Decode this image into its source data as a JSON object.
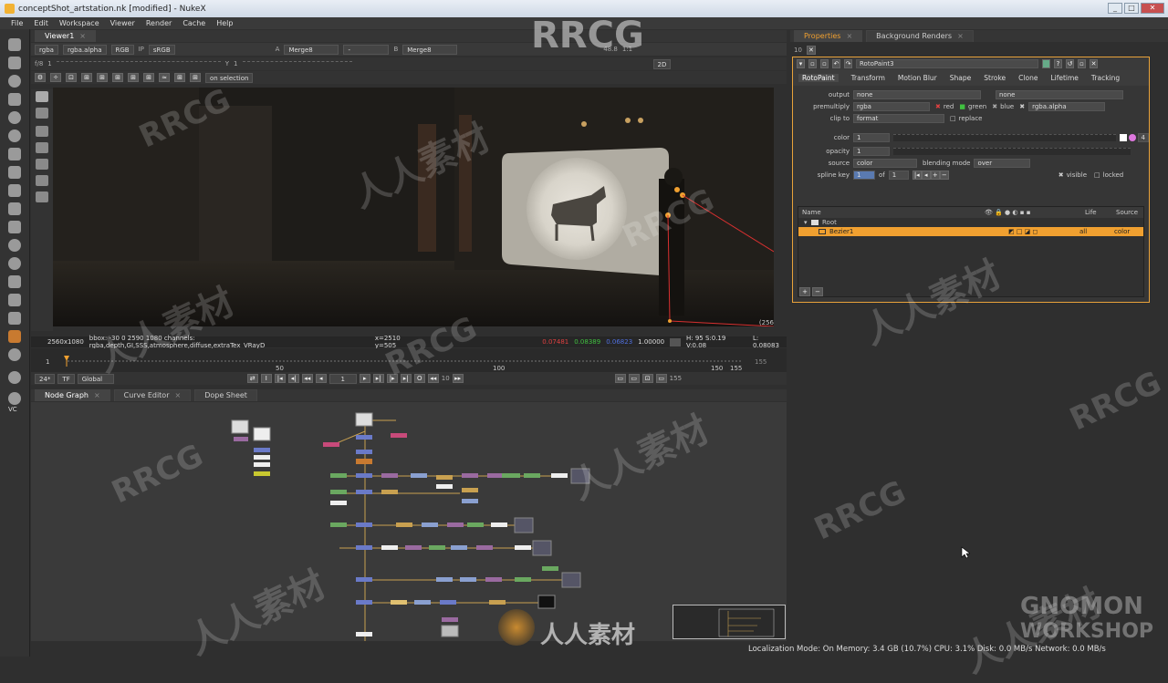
{
  "window": {
    "title": "conceptShot_artstation.nk [modified] - NukeX"
  },
  "menu": [
    "File",
    "Edit",
    "Workspace",
    "Viewer",
    "Render",
    "Cache",
    "Help"
  ],
  "viewer_tab": {
    "label": "Viewer1"
  },
  "viewer_controls": {
    "channels": "rgba",
    "alpha": "rgba.alpha",
    "colorspace": "RGB",
    "ip": "IP",
    "lut": "sRGB",
    "input_a_label": "A",
    "input_a": "Merge8",
    "dash": "-",
    "input_b_label": "B",
    "input_b": "Merge8",
    "gain": "48.8",
    "zoom": "1:1",
    "mode": "2D",
    "fstop": "f/8",
    "frame": "1",
    "gamma_label": "Y",
    "gamma": "1",
    "on_selection": "on selection"
  },
  "info": {
    "resolution": "2560x1080",
    "bbox": "bbox: -30 0 2590 1080 channels: rgba,depth,GI,SSS,atmosphere,diffuse,extraTex_VRayD",
    "coords": "x=2510 y=505",
    "r": "0.07481",
    "g": "0.08389",
    "b": "0.06823",
    "a": "1.00000",
    "hsv": "H: 95 S:0.19 V:0.08",
    "lum": "L: 0.08083",
    "overflow": "(256"
  },
  "timeline": {
    "start": "1",
    "mid1": "50",
    "mid2": "100",
    "mark150": "150",
    "end": "155",
    "end_frame": "155",
    "fps": "24*",
    "tf": "TF",
    "scope": "Global",
    "current": "1",
    "step": "10"
  },
  "graph_tabs": [
    "Node Graph",
    "Curve Editor",
    "Dope Sheet"
  ],
  "right_tabs": [
    "Properties",
    "Background Renders"
  ],
  "properties": {
    "count": "10",
    "node_name": "RotoPaint3",
    "tabs": [
      "RotoPaint",
      "Transform",
      "Motion Blur",
      "Shape",
      "Stroke",
      "Clone",
      "Lifetime",
      "Tracking"
    ],
    "output_label": "output",
    "output": "none",
    "output2": "none",
    "premult_label": "premultiply",
    "premult": "rgba",
    "red": "red",
    "green": "green",
    "blue": "blue",
    "alpha_channel": "rgba.alpha",
    "clipto_label": "clip to",
    "clipto": "format",
    "replace": "replace",
    "color_label": "color",
    "color": "1",
    "opacity_label": "opacity",
    "opacity": "1",
    "source_label": "source",
    "source": "color",
    "blend_label": "blending mode",
    "blend": "over",
    "splinekey_label": "spline key",
    "splinekey": "1",
    "of": "of",
    "of_val": "1",
    "visible": "visible",
    "locked": "locked",
    "slider_ticks": [
      "0",
      "0.01",
      "0.05",
      "0.1",
      "0.2",
      "0.3",
      "0.4",
      "0.5",
      "0.6",
      "0.7",
      "0.8",
      "0.9",
      "1"
    ],
    "color_val": "4"
  },
  "roto_list": {
    "headers": [
      "Name",
      "Life",
      "Source"
    ],
    "rows": [
      {
        "name": "Root",
        "life": "",
        "source": ""
      },
      {
        "name": "Bezier1",
        "life": "all",
        "source": "color"
      }
    ]
  },
  "status": "Localization Mode: On  Memory: 3.4 GB (10.7%)  CPU: 3.1%  Disk: 0.0 MB/s  Network: 0.0 MB/s",
  "watermarks": {
    "rrcg": "RRCG",
    "cn": "人人素材",
    "gnomon1": "GNOMON",
    "gnomon2": "WORKSHOP"
  },
  "colors": {
    "accent": "#f0a030",
    "node_purple": "#9a6aa0",
    "node_blue": "#6a7ac8",
    "node_green": "#6aa860"
  }
}
